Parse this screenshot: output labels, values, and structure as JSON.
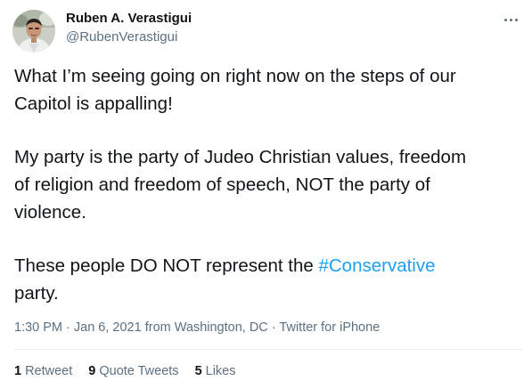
{
  "author": {
    "name": "Ruben A. Verastigui",
    "handle": "@RubenVerastigui"
  },
  "tweet": {
    "line1": "What I’m seeing going on right now on the steps of our",
    "line2": "Capitol is appalling!",
    "line3": "My party is the party of Judeo Christian values, freedom",
    "line4": "of religion and freedom of speech, NOT the party of",
    "line5": "violence.",
    "line6_prefix": "These people DO NOT represent the ",
    "hashtag": "#Conservative",
    "line7": "party."
  },
  "meta": {
    "time": "1:30 PM",
    "separator1": " · ",
    "date": "Jan 6, 2021",
    "from_text": " from ",
    "location": "Washington, DC",
    "separator2": " · ",
    "source": "Twitter for iPhone"
  },
  "stats": {
    "retweets_count": "1",
    "retweets_label": "Retweet",
    "quotes_count": "9",
    "quotes_label": "Quote Tweets",
    "likes_count": "5",
    "likes_label": "Likes"
  },
  "colors": {
    "link": "#1da1f2",
    "secondary_text": "#5b7083",
    "primary_text": "#0f1419",
    "divider": "#ebeef0"
  },
  "icons": {
    "more": "more-icon"
  }
}
